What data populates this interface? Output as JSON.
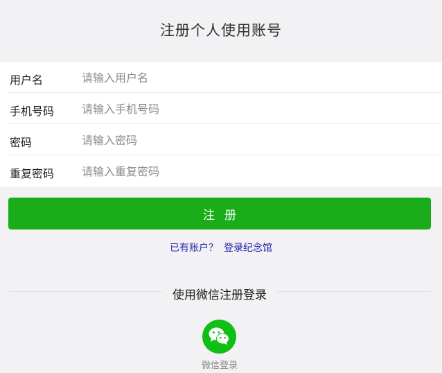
{
  "header": {
    "title": "注册个人使用账号"
  },
  "form": {
    "fields": [
      {
        "label": "用户名",
        "placeholder": "请输入用户名",
        "value": ""
      },
      {
        "label": "手机号码",
        "placeholder": "请输入手机号码",
        "value": ""
      },
      {
        "label": "密码",
        "placeholder": "请输入密码",
        "value": ""
      },
      {
        "label": "重复密码",
        "placeholder": "请输入重复密码",
        "value": ""
      }
    ],
    "submit_label": "注册"
  },
  "login": {
    "prompt": "已有账户？",
    "link_label": "登录纪念馆"
  },
  "social": {
    "divider_text": "使用微信注册登录",
    "wechat_label": "微信登录",
    "wechat_icon": "wechat-icon"
  },
  "colors": {
    "accent": "#1aad19",
    "wechat": "#0fbf13",
    "link": "#1a1ab0",
    "background": "#f2f2f4"
  }
}
